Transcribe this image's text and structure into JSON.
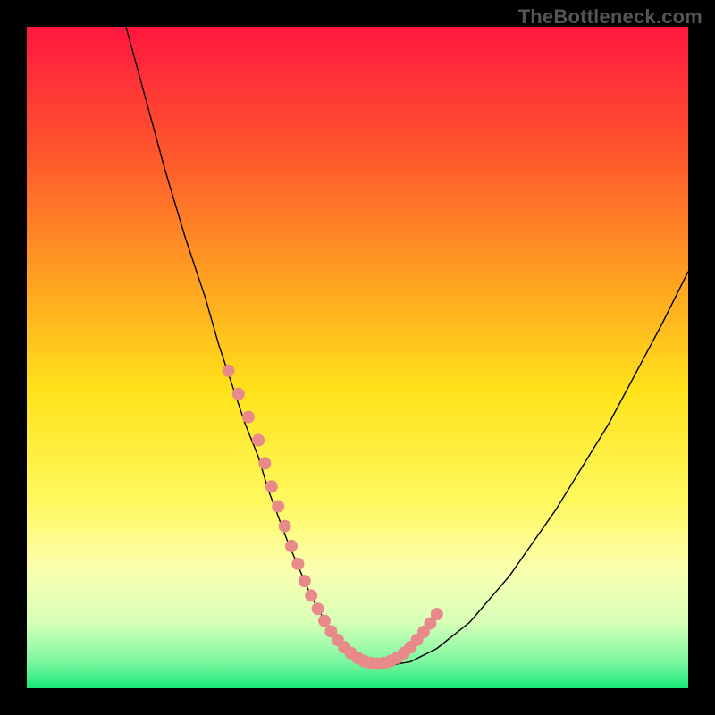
{
  "watermark": "TheBottleneck.com",
  "chart_data": {
    "type": "line",
    "title": "",
    "xlabel": "",
    "ylabel": "",
    "xlim": [
      0,
      100
    ],
    "ylim": [
      0,
      100
    ],
    "legend": false,
    "grid": false,
    "background_gradient": {
      "stops": [
        {
          "offset": 0.0,
          "color": "#ff163f"
        },
        {
          "offset": 0.2,
          "color": "#ff5a2c"
        },
        {
          "offset": 0.4,
          "color": "#ffa820"
        },
        {
          "offset": 0.55,
          "color": "#ffe21a"
        },
        {
          "offset": 0.72,
          "color": "#fff960"
        },
        {
          "offset": 0.82,
          "color": "#fbffb0"
        },
        {
          "offset": 0.9,
          "color": "#d8ffb8"
        },
        {
          "offset": 0.96,
          "color": "#7cf7a0"
        },
        {
          "offset": 1.0,
          "color": "#17e877"
        }
      ]
    },
    "series": [
      {
        "name": "bottleneck-curve",
        "color": "#000000",
        "stroke_width": 1.4,
        "x": [
          15,
          18,
          21,
          24,
          27,
          29,
          31,
          33,
          35,
          36.5,
          38,
          39.5,
          41,
          42.5,
          44,
          45.5,
          47,
          48.5,
          50,
          52,
          55,
          58,
          62,
          67,
          73,
          80,
          88,
          96,
          100
        ],
        "values": [
          100,
          89,
          78,
          68,
          59,
          52,
          46,
          40,
          35,
          30,
          26,
          22,
          18.5,
          15,
          12,
          9.5,
          7.5,
          6,
          5,
          4,
          3.5,
          4,
          6,
          10,
          17,
          27,
          40,
          55,
          63
        ]
      }
    ],
    "markers": [
      {
        "name": "highlight-dots",
        "color": "#e88a8a",
        "radius": 7,
        "x": [
          30.5,
          32,
          33.5,
          35,
          36,
          37,
          38,
          39,
          40,
          41,
          42,
          43,
          44,
          45,
          46,
          47,
          48,
          49,
          50,
          51,
          52,
          53,
          54,
          55,
          56,
          57,
          58,
          59,
          60,
          61,
          62
        ],
        "values": [
          48,
          44.5,
          41,
          37.5,
          34,
          30.5,
          27.5,
          24.5,
          21.5,
          18.8,
          16.2,
          14,
          12,
          10.2,
          8.6,
          7.3,
          6.2,
          5.3,
          4.6,
          4.1,
          3.8,
          3.7,
          3.8,
          4.1,
          4.6,
          5.3,
          6.2,
          7.3,
          8.5,
          9.8,
          11.2
        ]
      }
    ]
  }
}
